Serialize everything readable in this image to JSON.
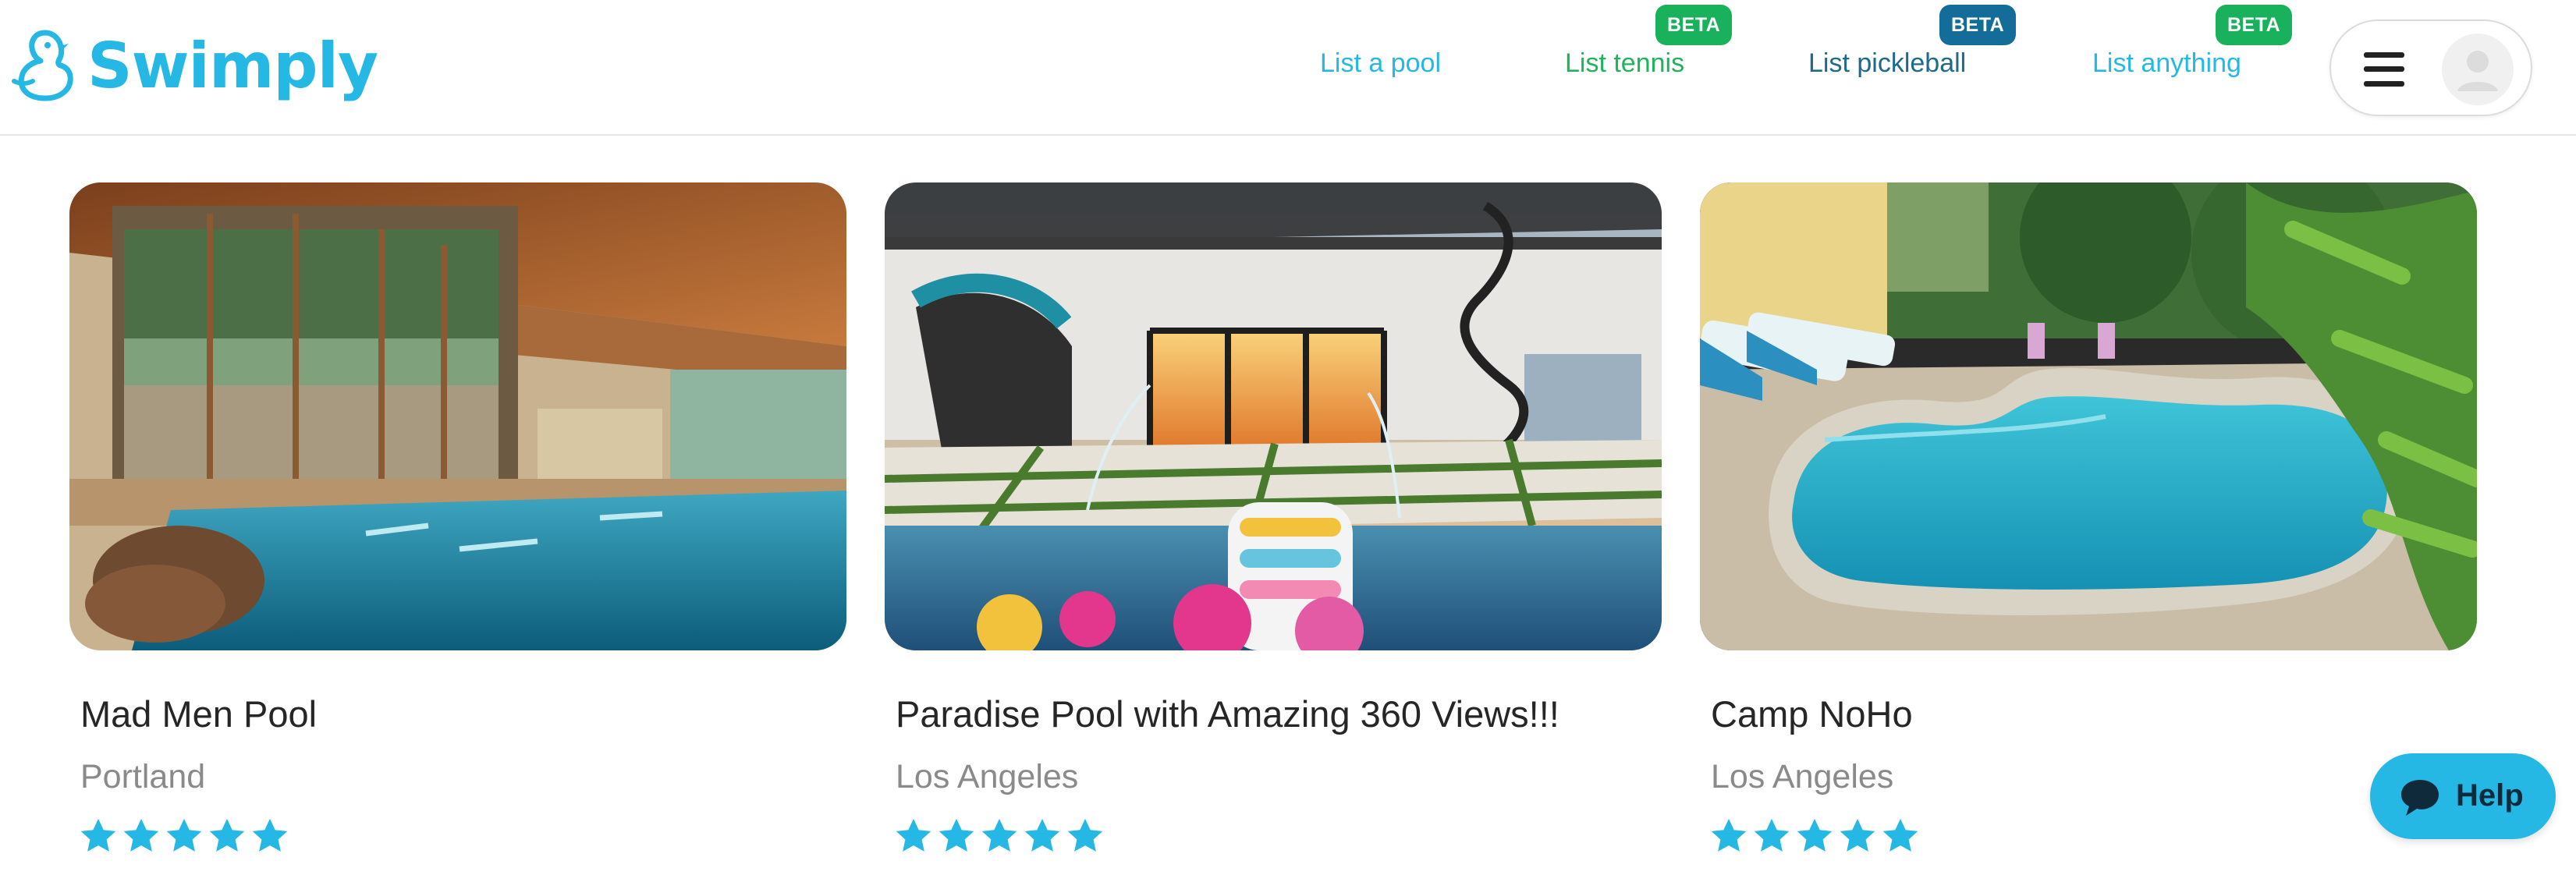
{
  "brand": {
    "name": "Swimply",
    "color": "#26b8e4"
  },
  "nav": {
    "items": [
      {
        "label": "List a pool",
        "badge": ""
      },
      {
        "label": "List tennis",
        "badge": "BETA"
      },
      {
        "label": "List pickleball",
        "badge": "BETA"
      },
      {
        "label": "List anything",
        "badge": "BETA"
      }
    ]
  },
  "user_menu": {
    "menu_icon": "hamburger-icon",
    "avatar_icon": "user-avatar-icon"
  },
  "listings": [
    {
      "title": "Mad Men Pool",
      "city": "Portland",
      "rating": 5
    },
    {
      "title": "Paradise Pool with Amazing 360 Views!!!",
      "city": "Los Angeles",
      "rating": 5
    },
    {
      "title": "Camp NoHo",
      "city": "Los Angeles",
      "rating": 5
    }
  ],
  "help": {
    "label": "Help",
    "icon": "chat-bubble-icon"
  },
  "colors": {
    "star": "#26b8e4",
    "beta_green": "#19b15b",
    "beta_blue": "#146d98",
    "tennis": "#21b35c",
    "pickleball": "#1d6a8d"
  }
}
